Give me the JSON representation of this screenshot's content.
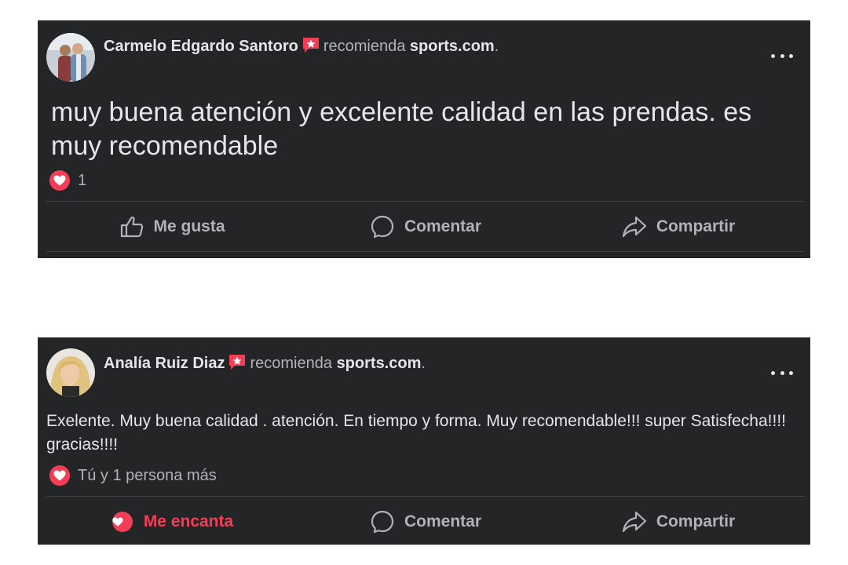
{
  "posts": [
    {
      "author": "Carmelo Edgardo Santoro",
      "verb": "recomienda",
      "page": "sports.com",
      "punct": ".",
      "text": "muy buena atención y excelente calidad en las prendas. es muy recomendable",
      "reactions_text": "1",
      "actions": {
        "like": "Me gusta",
        "comment": "Comentar",
        "share": "Compartir"
      }
    },
    {
      "author": "Analía Ruiz Diaz",
      "verb": "recomienda",
      "page": "sports.com",
      "punct": ".",
      "text": "Exelente. Muy buena calidad . atención. En tiempo y forma. Muy recomendable!!! super Satisfecha!!!! gracias!!!!",
      "reactions_text": "Tú y 1 persona más",
      "actions": {
        "like": "Me encanta",
        "comment": "Comentar",
        "share": "Compartir"
      }
    }
  ],
  "colors": {
    "card_bg": "#242526",
    "text_primary": "#e4e6eb",
    "text_secondary": "#b0b3b8",
    "love_red": "#f33e58",
    "divider": "#3e4042"
  },
  "icons": {
    "recommend": "recommendation-star-icon",
    "more": "more-options-icon",
    "heart": "heart-reaction-icon",
    "like": "thumbs-up-icon",
    "comment": "comment-bubble-icon",
    "share": "share-arrow-icon"
  }
}
